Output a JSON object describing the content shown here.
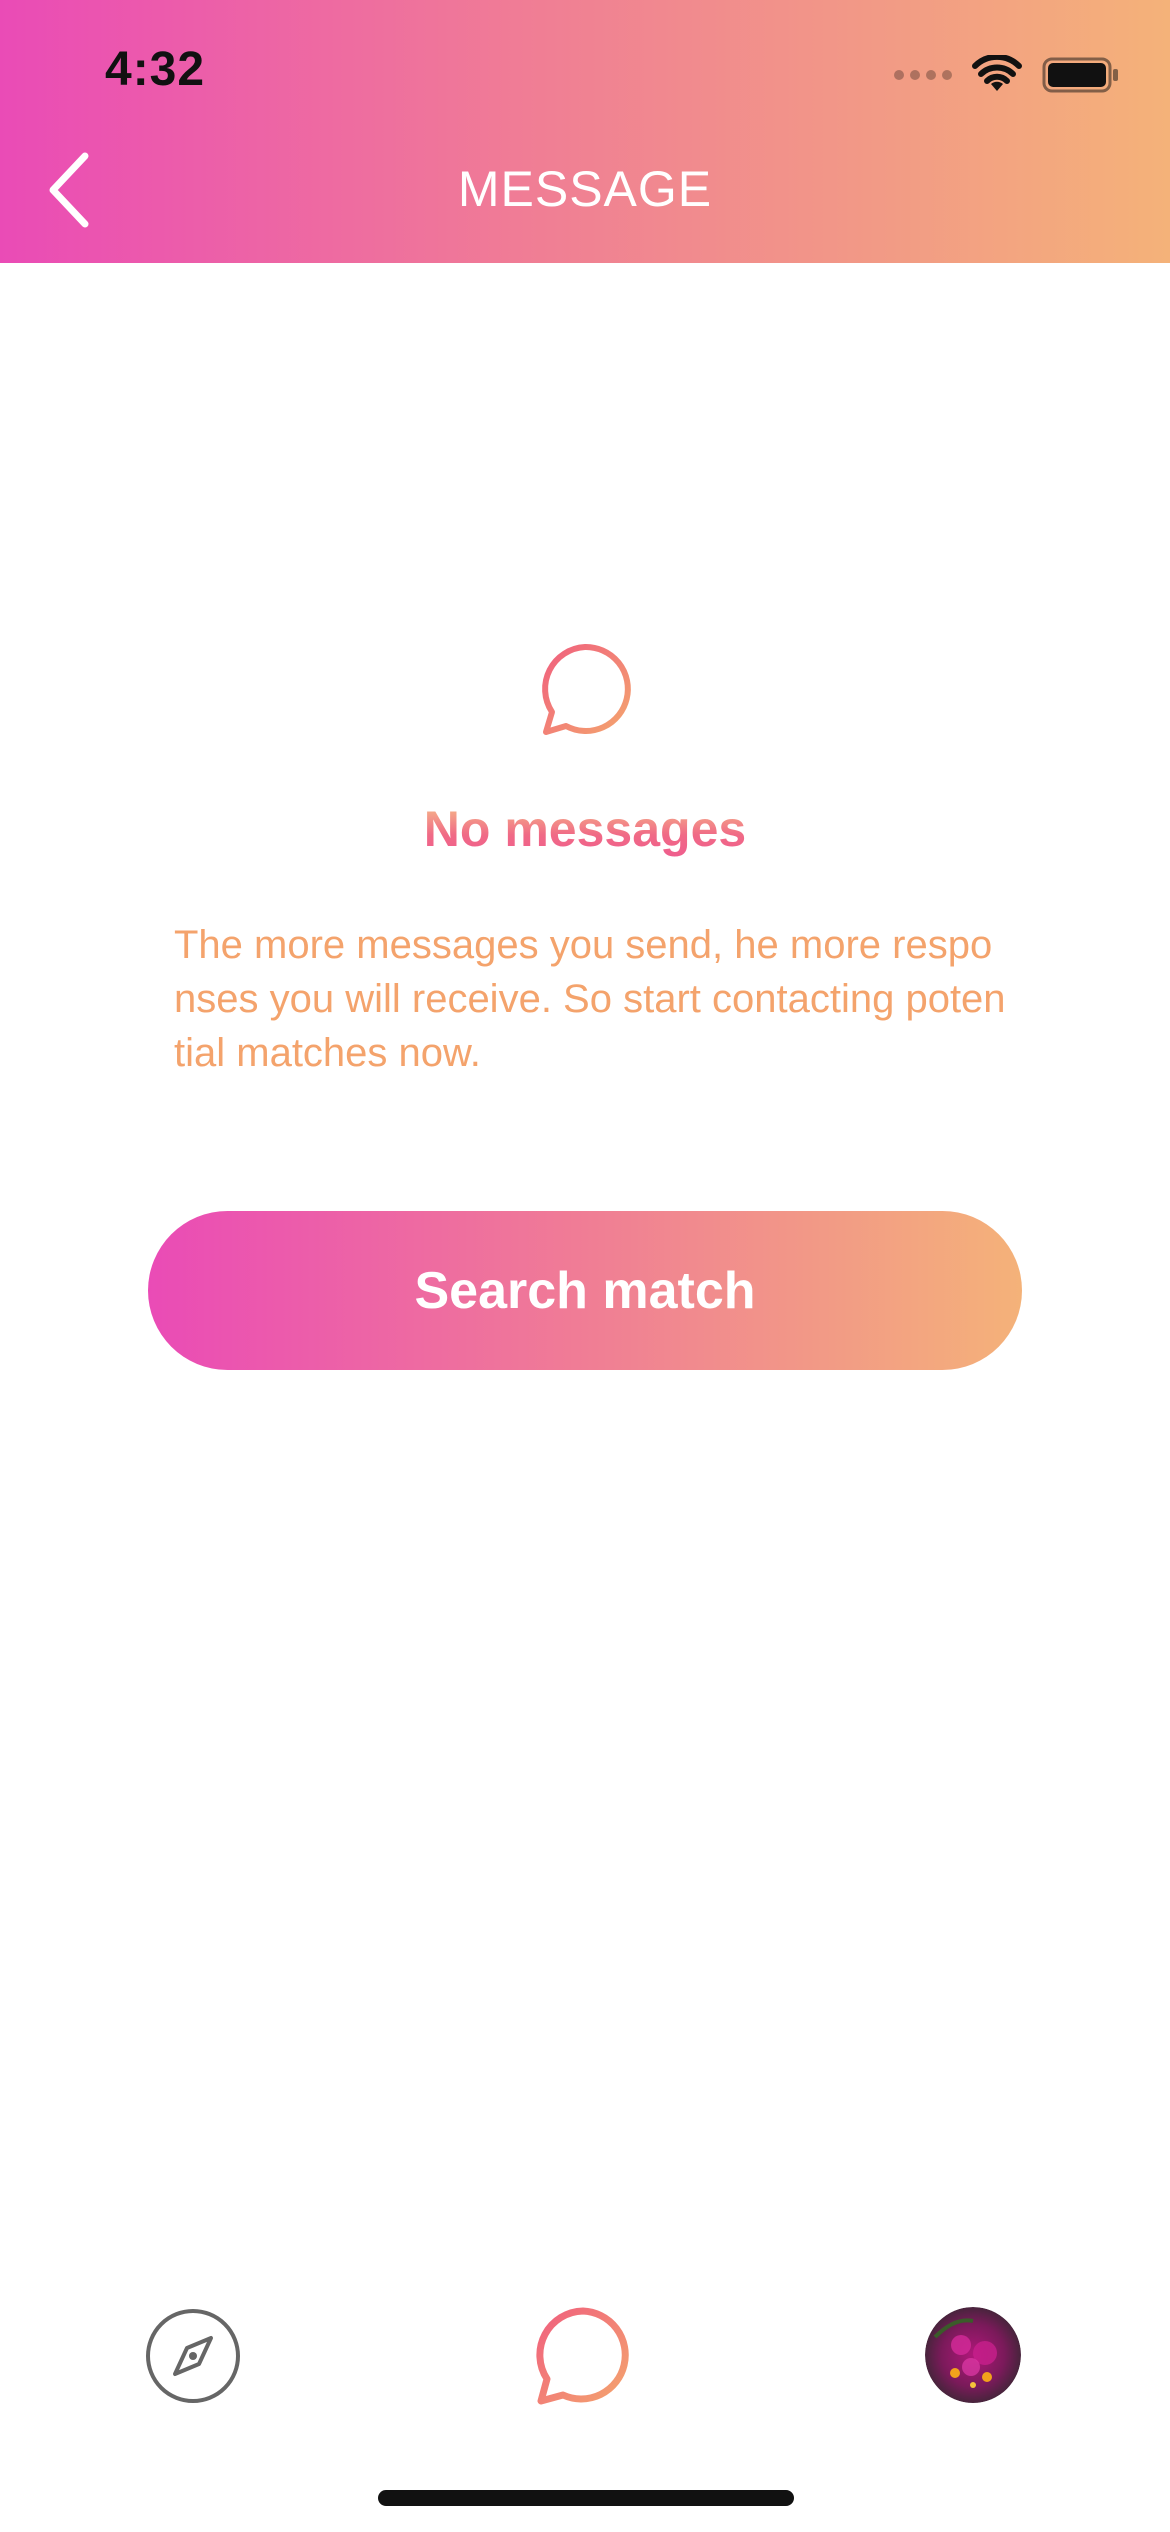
{
  "status_bar": {
    "time": "4:32"
  },
  "nav": {
    "title": "MESSAGE",
    "back_icon": "chevron-left-icon"
  },
  "empty_state": {
    "icon": "chat-bubble-icon",
    "title": "No messages",
    "description": "The more messages you send, he more responses you will receive. So start contacting potential matches now."
  },
  "search_button": {
    "label": "Search match"
  },
  "tab_bar": {
    "items": [
      {
        "icon": "compass-icon"
      },
      {
        "icon": "chat-bubble-icon"
      },
      {
        "icon": "avatar"
      }
    ]
  },
  "colors": {
    "gradient_start": "#ea4bb6",
    "gradient_mid": "#f07d95",
    "gradient_end": "#f4b279",
    "description_text": "#f4a36c"
  }
}
